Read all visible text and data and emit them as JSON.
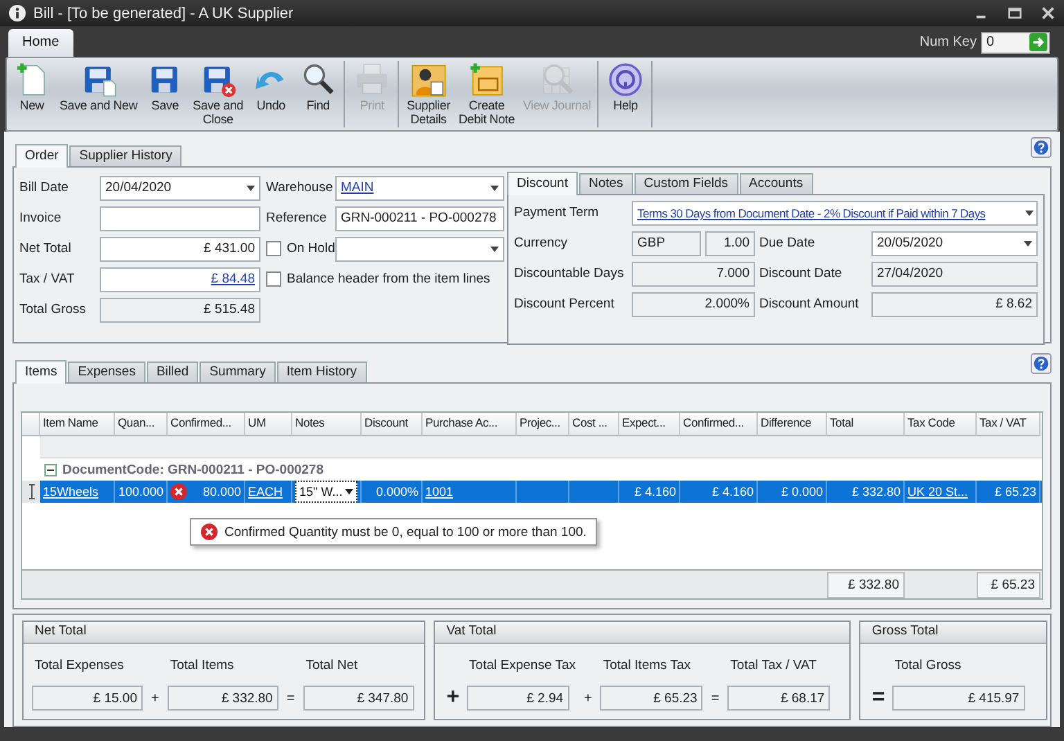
{
  "window": {
    "title": "Bill - [To be generated] - A UK Supplier"
  },
  "ribbon": {
    "tabs": [
      {
        "label": "Home",
        "selected": true
      }
    ],
    "num_key": {
      "label": "Num Key",
      "value": "0"
    },
    "groups": [
      {
        "buttons": [
          {
            "label": "New",
            "disabled": false
          },
          {
            "label": "Save and New",
            "disabled": false
          },
          {
            "label": "Save",
            "disabled": false
          },
          {
            "label": "Save and\nClose",
            "disabled": false
          },
          {
            "label": "Undo",
            "disabled": false
          },
          {
            "label": "Find",
            "disabled": false
          }
        ]
      },
      {
        "buttons": [
          {
            "label": "Print",
            "disabled": true
          }
        ]
      },
      {
        "buttons": [
          {
            "label": "Supplier\nDetails",
            "disabled": false
          },
          {
            "label": "Create\nDebit Note",
            "disabled": false
          },
          {
            "label": "View Journal",
            "disabled": true
          }
        ]
      },
      {
        "buttons": [
          {
            "label": "Help",
            "disabled": false
          }
        ]
      }
    ]
  },
  "order": {
    "tabs": [
      {
        "label": "Order",
        "selected": true
      },
      {
        "label": "Supplier History",
        "selected": false
      }
    ],
    "bill_date": {
      "label": "Bill Date",
      "value": "20/04/2020"
    },
    "warehouse": {
      "label": "Warehouse",
      "value": "MAIN"
    },
    "invoice": {
      "label": "Invoice"
    },
    "reference": {
      "label": "Reference",
      "value": "GRN-000211 - PO-000278"
    },
    "net_total": {
      "label": "Net Total",
      "value": "£ 431.00"
    },
    "on_hold": {
      "label": "On Hold",
      "checked": false
    },
    "tax_vat": {
      "label": "Tax / VAT",
      "value": "£ 84.48"
    },
    "balance_header": {
      "label": "Balance header from the item lines",
      "checked": false
    },
    "total_gross": {
      "label": "Total Gross",
      "value": "£ 515.48"
    }
  },
  "discount": {
    "tabs": [
      {
        "label": "Discount",
        "selected": true
      },
      {
        "label": "Notes",
        "selected": false
      },
      {
        "label": "Custom Fields",
        "selected": false
      },
      {
        "label": "Accounts",
        "selected": false
      }
    ],
    "payment_term": {
      "label": "Payment Term",
      "value": "Terms 30 Days from Document Date - 2% Discount if Paid within 7 Days"
    },
    "currency": {
      "label": "Currency",
      "code": "GBP",
      "rate": "1.00"
    },
    "due_date": {
      "label": "Due Date",
      "value": "20/05/2020"
    },
    "discountable_days": {
      "label": "Discountable Days",
      "value": "7.000"
    },
    "discount_date": {
      "label": "Discount Date",
      "value": "27/04/2020"
    },
    "discount_percent": {
      "label": "Discount Percent",
      "value": "2.000%"
    },
    "discount_amount": {
      "label": "Discount Amount",
      "value": "£ 8.62"
    }
  },
  "items": {
    "tabs": [
      {
        "label": "Items",
        "selected": true
      },
      {
        "label": "Expenses",
        "selected": false
      },
      {
        "label": "Billed",
        "selected": false
      },
      {
        "label": "Summary",
        "selected": false
      },
      {
        "label": "Item History",
        "selected": false
      }
    ],
    "table": {
      "columns": [
        "Item Name",
        "Quan...",
        "Confirmed...",
        "UM",
        "Notes",
        "Discount",
        "Purchase Ac...",
        "Projec...",
        "Cost ...",
        "Expect...",
        "Confirmed...",
        "Difference",
        "Total",
        "Tax Code",
        "Tax / VAT"
      ],
      "groups": [
        {
          "label": "DocumentCode: GRN-000211 - PO-000278",
          "expanded": true,
          "rows": [
            {
              "selected": true,
              "cells": [
                {
                  "text": "15Wheels",
                  "link": true
                },
                {
                  "text": "100.000"
                },
                {
                  "text": "80.000",
                  "error": true
                },
                {
                  "text": "EACH",
                  "link": true
                },
                {
                  "text": "15\" W...",
                  "kind": "combo"
                },
                {
                  "text": "0.000%"
                },
                {
                  "text": "1001",
                  "link": true
                },
                {},
                {},
                {
                  "text": "£ 4.160"
                },
                {
                  "text": "£ 4.160"
                },
                {
                  "text": "£ 0.000"
                },
                {
                  "text": "£ 332.80"
                },
                {
                  "text": "UK 20 St...",
                  "link": true
                },
                {
                  "text": "£ 65.23"
                }
              ]
            }
          ]
        }
      ],
      "error": "Confirmed Quantity must be 0, equal to 100 or more than 100.",
      "footer": {
        "total": "£ 332.80",
        "tax_vat": "£ 65.23"
      }
    }
  },
  "totals": [
    {
      "title": "Net Total",
      "items": [
        {
          "kind": "field",
          "label": "Total Expenses",
          "value": "£ 15.00"
        },
        {
          "kind": "op",
          "text": "+"
        },
        {
          "kind": "field",
          "label": "Total Items",
          "value": "£ 332.80"
        },
        {
          "kind": "op",
          "text": "="
        },
        {
          "kind": "field",
          "label": "Total Net",
          "value": "£ 347.80"
        }
      ]
    },
    {
      "title": "Vat Total",
      "items": [
        {
          "kind": "bigop",
          "text": "+"
        },
        {
          "kind": "field",
          "label": "Total Expense Tax",
          "value": "£ 2.94"
        },
        {
          "kind": "op",
          "text": "+"
        },
        {
          "kind": "field",
          "label": "Total Items Tax",
          "value": "£ 65.23"
        },
        {
          "kind": "op",
          "text": "="
        },
        {
          "kind": "field",
          "label": "Total Tax / VAT",
          "value": "£ 68.17"
        }
      ]
    },
    {
      "title": "Gross Total",
      "items": [
        {
          "kind": "bigop",
          "text": "="
        },
        {
          "kind": "field",
          "label": "Total Gross",
          "value": "£ 415.97"
        }
      ]
    }
  ]
}
